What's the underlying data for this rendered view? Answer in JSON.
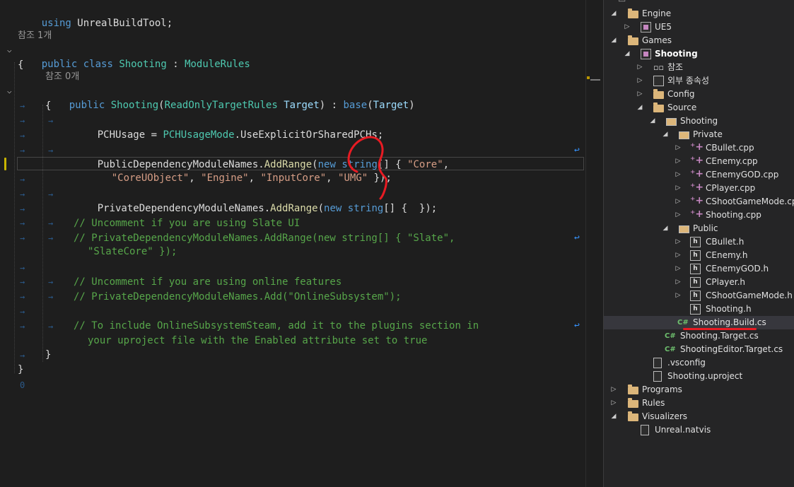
{
  "editor": {
    "codelens_1": "참조 1개",
    "codelens_2": "참조 0개",
    "line_using": [
      "using",
      " UnrealBuildTool;"
    ],
    "class_decl": [
      "public",
      " ",
      "class",
      " ",
      "Shooting",
      " : ",
      "ModuleRules"
    ],
    "brace_open_1": "{",
    "ctor_decl": [
      "public",
      " ",
      "Shooting",
      "(",
      "ReadOnlyTargetRules",
      " ",
      "Target",
      ") : ",
      "base",
      "(",
      "Target",
      ")"
    ],
    "brace_open_2": "{",
    "pch_line": [
      "PCHUsage",
      " = ",
      "PCHUsageMode",
      ".UseExplicitOrSharedPCHs;"
    ],
    "public_dep_line": [
      "PublicDependencyModuleNames",
      ".",
      "AddRange",
      "(",
      "new",
      " ",
      "string",
      "[] { ",
      "\"Core\"",
      ","
    ],
    "public_dep_wrap": [
      "\"CoreUObject\"",
      ", ",
      "\"Engine\"",
      ", ",
      "\"InputCore\"",
      ", ",
      "\"UMG\"",
      " });"
    ],
    "private_dep_line": [
      "PrivateDependencyModuleNames",
      ".",
      "AddRange",
      "(",
      "new",
      " ",
      "string",
      "[] {  });"
    ],
    "comment_slate_1": "// Uncomment if you are using Slate UI",
    "comment_slate_2": "// PrivateDependencyModuleNames.AddRange(new string[] { \"Slate\",",
    "comment_slate_3": "\"SlateCore\" });",
    "comment_online_1": "// Uncomment if you are using online features",
    "comment_online_2": "// PrivateDependencyModuleNames.Add(\"OnlineSubsystem\");",
    "comment_steam_1": "// To include OnlineSubsystemSteam, add it to the plugins section in",
    "comment_steam_2": "your uproject file with the Enabled attribute set to true",
    "brace_close_2": "}",
    "brace_close_1": "}"
  },
  "explorer": {
    "items": [
      {
        "label": "Engine"
      },
      {
        "label": "UE5"
      },
      {
        "label": "Games"
      },
      {
        "label": "Shooting"
      },
      {
        "label": "참조"
      },
      {
        "label": "외부 종속성"
      },
      {
        "label": "Config"
      },
      {
        "label": "Source"
      },
      {
        "label": "Shooting"
      },
      {
        "label": "Private"
      },
      {
        "label": "CBullet.cpp"
      },
      {
        "label": "CEnemy.cpp"
      },
      {
        "label": "CEnemyGOD.cpp"
      },
      {
        "label": "CPlayer.cpp"
      },
      {
        "label": "CShootGameMode.cp"
      },
      {
        "label": "Shooting.cpp"
      },
      {
        "label": "Public"
      },
      {
        "label": "CBullet.h"
      },
      {
        "label": "CEnemy.h"
      },
      {
        "label": "CEnemyGOD.h"
      },
      {
        "label": "CPlayer.h"
      },
      {
        "label": "CShootGameMode.h"
      },
      {
        "label": "Shooting.h"
      },
      {
        "label": "Shooting.Build.cs"
      },
      {
        "label": "Shooting.Target.cs"
      },
      {
        "label": "ShootingEditor.Target.cs"
      },
      {
        "label": ".vsconfig"
      },
      {
        "label": "Shooting.uproject"
      },
      {
        "label": "Programs"
      },
      {
        "label": "Rules"
      },
      {
        "label": "Visualizers"
      },
      {
        "label": "Unreal.natvis"
      }
    ]
  },
  "colors": {
    "keyword": "#569cd6",
    "type": "#4ec9b0",
    "method": "#dcdcaa",
    "string": "#d69d85",
    "comment": "#57a64a",
    "selection": "#37373d",
    "annotation": "#e81b23"
  },
  "icons": {
    "expanded": "triangle-down-icon",
    "collapsed": "triangle-right-icon",
    "folder": "folder-icon",
    "cs": "csharp-file-icon",
    "cpp": "cpp-file-icon",
    "h": "header-file-icon"
  }
}
